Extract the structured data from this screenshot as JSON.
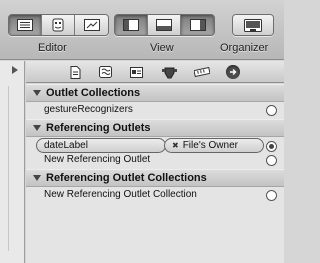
{
  "toolbar": {
    "editor_label": "Editor",
    "view_label": "View",
    "organizer_label": "Organizer",
    "editor_buttons": [
      "standard-editor-icon",
      "assistant-editor-icon",
      "version-editor-icon"
    ],
    "view_buttons": [
      "navigator-toggle-icon",
      "debug-area-toggle-icon",
      "utilities-toggle-icon"
    ],
    "organizer_button": "organizer-window-icon"
  },
  "inspector_tabs": [
    "file-inspector-icon",
    "quick-help-icon",
    "identity-inspector-icon",
    "attributes-inspector-icon",
    "size-inspector-icon",
    "connections-inspector-icon"
  ],
  "panel": {
    "outlet_collections": {
      "title": "Outlet Collections",
      "rows": [
        "gestureRecognizers"
      ]
    },
    "referencing_outlets": {
      "title": "Referencing Outlets",
      "connection": {
        "outlet": "dateLabel",
        "target": "File's Owner"
      },
      "new_row": "New Referencing Outlet"
    },
    "referencing_outlet_collections": {
      "title": "Referencing Outlet Collections",
      "new_row": "New Referencing Outlet Collection"
    }
  }
}
